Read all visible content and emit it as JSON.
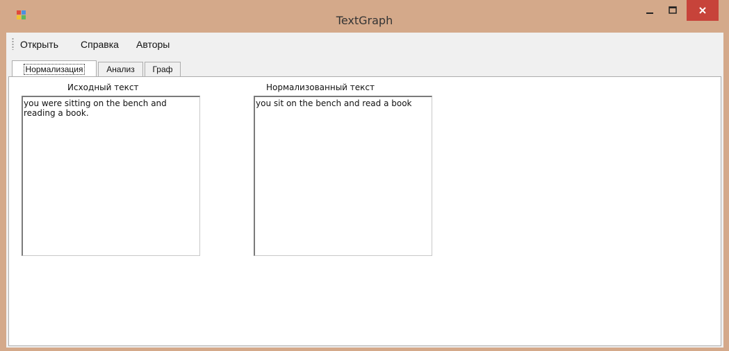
{
  "window": {
    "title": "TextGraph",
    "controls": {
      "minimize": "–",
      "maximize": "□",
      "close": "✕"
    }
  },
  "menu": {
    "items": [
      "Открыть",
      "Справка",
      "Авторы"
    ]
  },
  "tabs": [
    {
      "label": "Нормализация",
      "active": true
    },
    {
      "label": "Анализ",
      "active": false
    },
    {
      "label": "Граф",
      "active": false
    }
  ],
  "normalization": {
    "source_label": "Исходный текст",
    "source_text": "you were sitting on the bench and reading a book.",
    "normalized_label": "Нормализованный текст",
    "normalized_text": "you sit on the bench and read a book"
  },
  "colors": {
    "titlebar": "#d4a98a",
    "close_button": "#c7433a",
    "client_bg": "#f0f0f0"
  }
}
